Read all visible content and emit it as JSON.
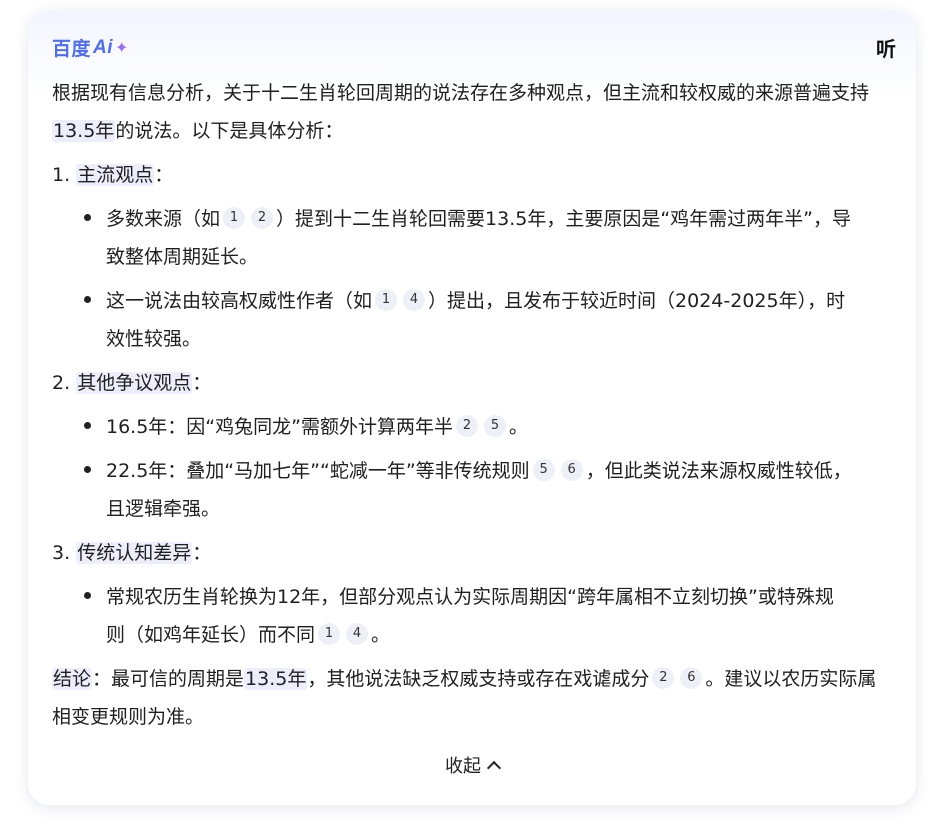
{
  "header": {
    "logo_text": "百度",
    "logo_ai": "Ai",
    "logo_sparkle": "✦",
    "listen_label": "听"
  },
  "intro": {
    "text_a": "根据现有信息分析，关于十二生肖轮回周期的说法存在多种观点，但主流和较权威的来源普遍支持",
    "highlight": "13.5年",
    "text_b": "的说法。以下是具体分析："
  },
  "sections": [
    {
      "num": "1.",
      "title": "主流观点",
      "colon": "：",
      "items": [
        {
          "text_a": "多数来源（如",
          "cites": [
            "1",
            "2"
          ],
          "text_b": "）提到十二生肖轮回需要13.5年，主要原因是“鸡年需过两年半”，导致整体周期延长。"
        },
        {
          "text_a": "这一说法由较高权威性作者（如",
          "cites": [
            "1",
            "4"
          ],
          "text_b": "）提出，且发布于较近时间（2024-2025年），时效性较强。"
        }
      ]
    },
    {
      "num": "2.",
      "title": "其他争议观点",
      "colon": "：",
      "items": [
        {
          "text_a": "16.5年：因“鸡兔同龙”需额外计算两年半",
          "cites": [
            "2",
            "5"
          ],
          "text_b": "。"
        },
        {
          "text_a": "22.5年：叠加“马加七年”“蛇减一年”等非传统规则",
          "cites": [
            "5",
            "6"
          ],
          "text_b": "，但此类说法来源权威性较低，且逻辑牵强。"
        }
      ]
    },
    {
      "num": "3.",
      "title": "传统认知差异",
      "colon": "：",
      "items": [
        {
          "text_a": "常规农历生肖轮换为12年，但部分观点认为实际周期因“跨年属相不立刻切换”或特殊规则（如鸡年延长）而不同",
          "cites": [
            "1",
            "4"
          ],
          "text_b": "。"
        }
      ]
    }
  ],
  "conclusion": {
    "label": "结论",
    "text_a": "：最可信的周期是",
    "highlight": "13.5年",
    "text_b": "，其他说法缺乏权威支持或存在戏谑成分",
    "cites": [
      "2",
      "6"
    ],
    "text_c": "。建议以农历实际属相变更规则为准。"
  },
  "collapse_label": "收起"
}
